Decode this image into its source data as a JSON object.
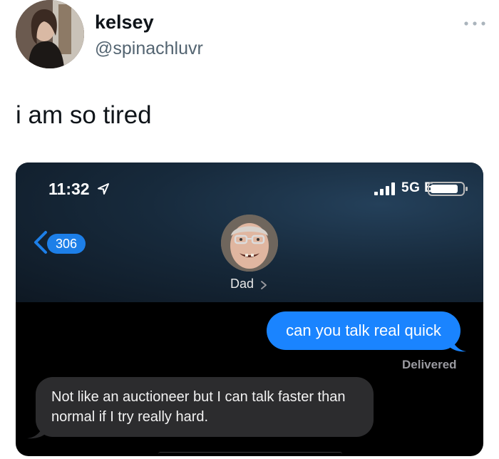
{
  "tweet": {
    "display_name": "kelsey",
    "handle": "@spinachluvr",
    "text": "i am so tired",
    "more_icon": "ellipsis-icon"
  },
  "phone": {
    "status_time": "11:32",
    "network": "5G E",
    "back_count": "306",
    "contact_name": "Dad",
    "messages": [
      {
        "direction": "outgoing",
        "text": "can you talk real quick"
      },
      {
        "direction": "incoming",
        "text": "Not like an auctioneer but I can talk faster than normal if I try really hard."
      }
    ],
    "delivered_label": "Delivered"
  },
  "colors": {
    "outgoing_bubble": "#1a84ff",
    "incoming_bubble": "#2c2c2e",
    "badge": "#1d7fe8"
  }
}
